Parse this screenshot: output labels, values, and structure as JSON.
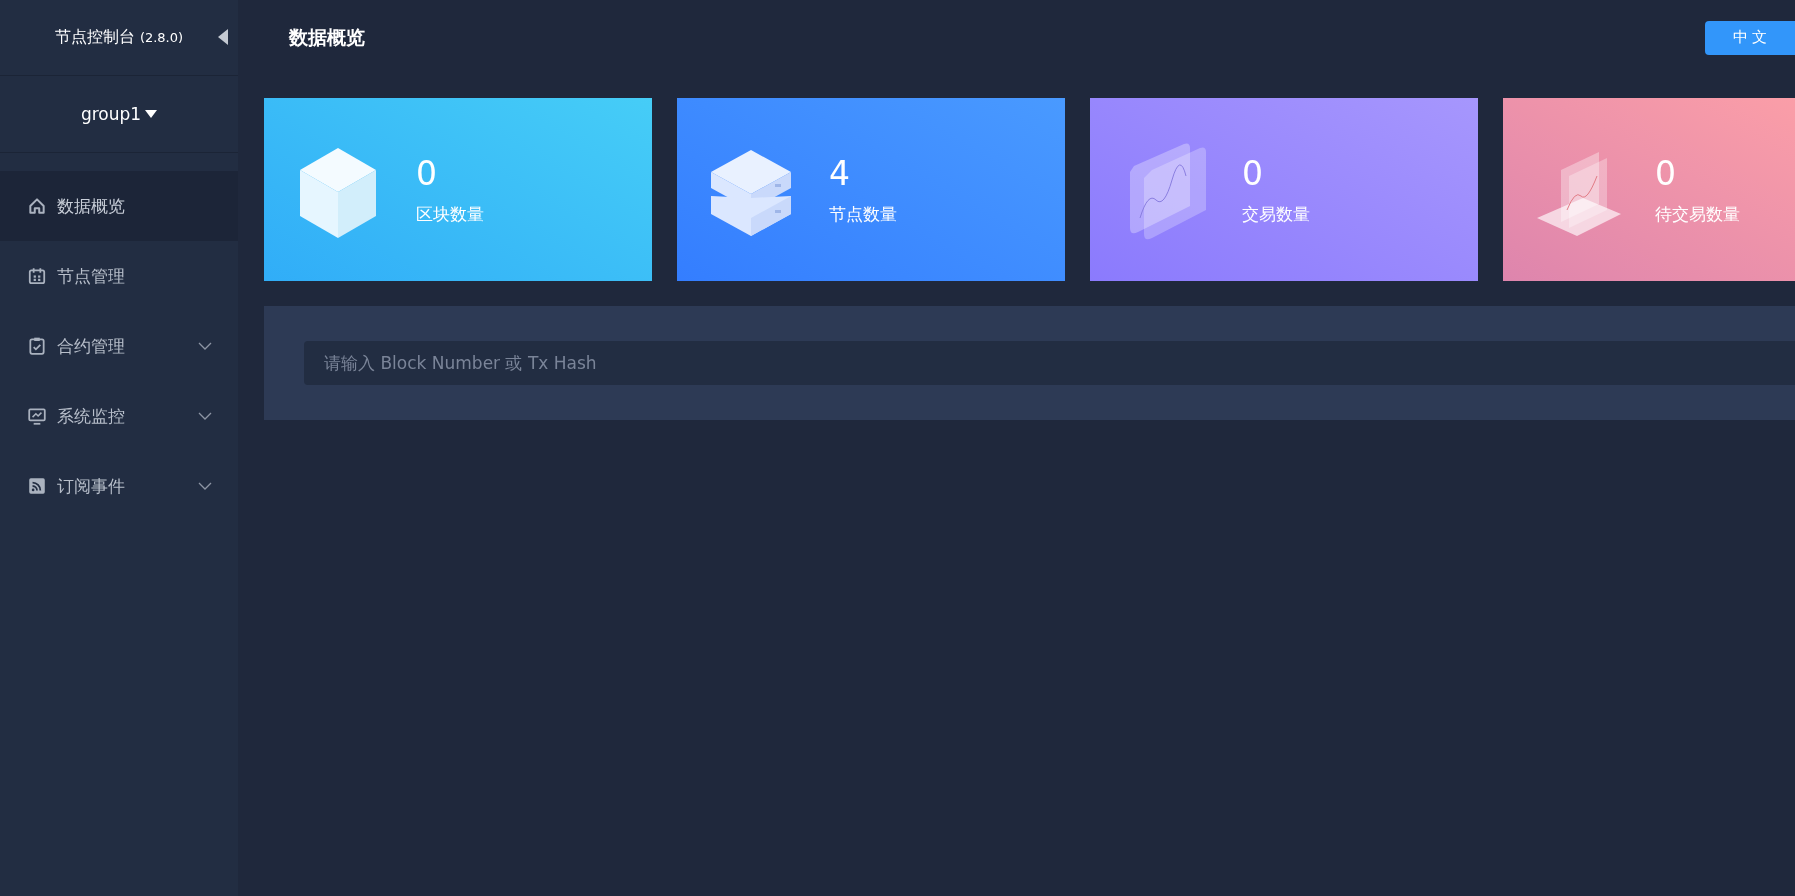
{
  "sidebar": {
    "title": "节点控制台",
    "version": "(2.8.0)",
    "group": "group1",
    "items": [
      {
        "label": "数据概览",
        "selected": true,
        "expandable": false
      },
      {
        "label": "节点管理",
        "selected": false,
        "expandable": false
      },
      {
        "label": "合约管理",
        "selected": false,
        "expandable": true
      },
      {
        "label": "系统监控",
        "selected": false,
        "expandable": true
      },
      {
        "label": "订阅事件",
        "selected": false,
        "expandable": true
      }
    ]
  },
  "header": {
    "title": "数据概览",
    "language_button": "中 文"
  },
  "cards": [
    {
      "value": "0",
      "label": "区块数量",
      "color": "#2cc6f6"
    },
    {
      "value": "4",
      "label": "节点数量",
      "color": "#308cff"
    },
    {
      "value": "0",
      "label": "交易数量",
      "color": "#9a88fd"
    },
    {
      "value": "0",
      "label": "待交易数量",
      "color": "#ff959b"
    }
  ],
  "search": {
    "placeholder": "请输入 Block Number 或 Tx Hash"
  }
}
